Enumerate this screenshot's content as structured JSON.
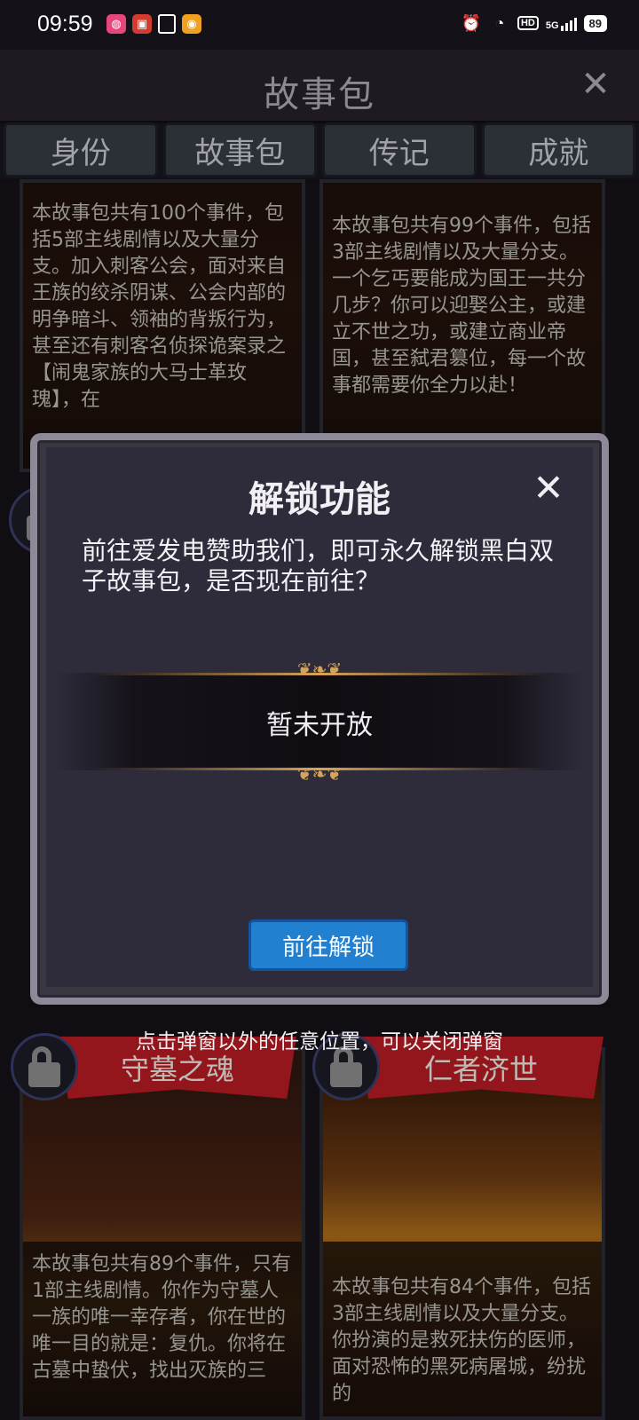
{
  "status_bar": {
    "time": "09:59",
    "signal_label": "5G",
    "battery": "89"
  },
  "header": {
    "title": "故事包"
  },
  "tabs": [
    {
      "label": "身份"
    },
    {
      "label": "故事包"
    },
    {
      "label": "传记"
    },
    {
      "label": "成就"
    }
  ],
  "cards": [
    {
      "text": "本故事包共有100个事件，包括5部主线剧情以及大量分支。加入刺客公会，面对来自王族的绞杀阴谋、公会内部的明争暗斗、领袖的背叛行为，甚至还有刺客名侦探诡案录之【闹鬼家族的大马士革玫瑰】，在"
    },
    {
      "text": "本故事包共有99个事件，包括3部主线剧情以及大量分支。一个乞丐要能成为国王一共分几步？你可以迎娶公主，或建立不世之功，或建立商业帝国，甚至弑君篡位，每一个故事都需要你全力以赴！"
    },
    {
      "title": "守墓之魂",
      "text": "本故事包共有89个事件，只有1部主线剧情。你作为守墓人一族的唯一幸存者，你在世的唯一目的就是：复仇。你将在古墓中蛰伏，找出灭族的三"
    },
    {
      "title": "仁者济世",
      "text": "本故事包共有84个事件，包括3部主线剧情以及大量分支。你扮演的是救死扶伤的医师，面对恐怖的黑死病屠城，纷扰的"
    }
  ],
  "modal": {
    "title": "解锁功能",
    "message": "前往爱发电赞助我们，即可永久解锁黑白双子故事包，是否现在前往？",
    "banner_text": "暂未开放",
    "button_label": "前往解锁"
  },
  "hint": "点击弹窗以外的任意位置，可以关闭弹窗",
  "colors": {
    "accent_blue": "#2280d0",
    "ribbon_red": "#b31c22",
    "ornament_gold": "#d6a35a"
  }
}
